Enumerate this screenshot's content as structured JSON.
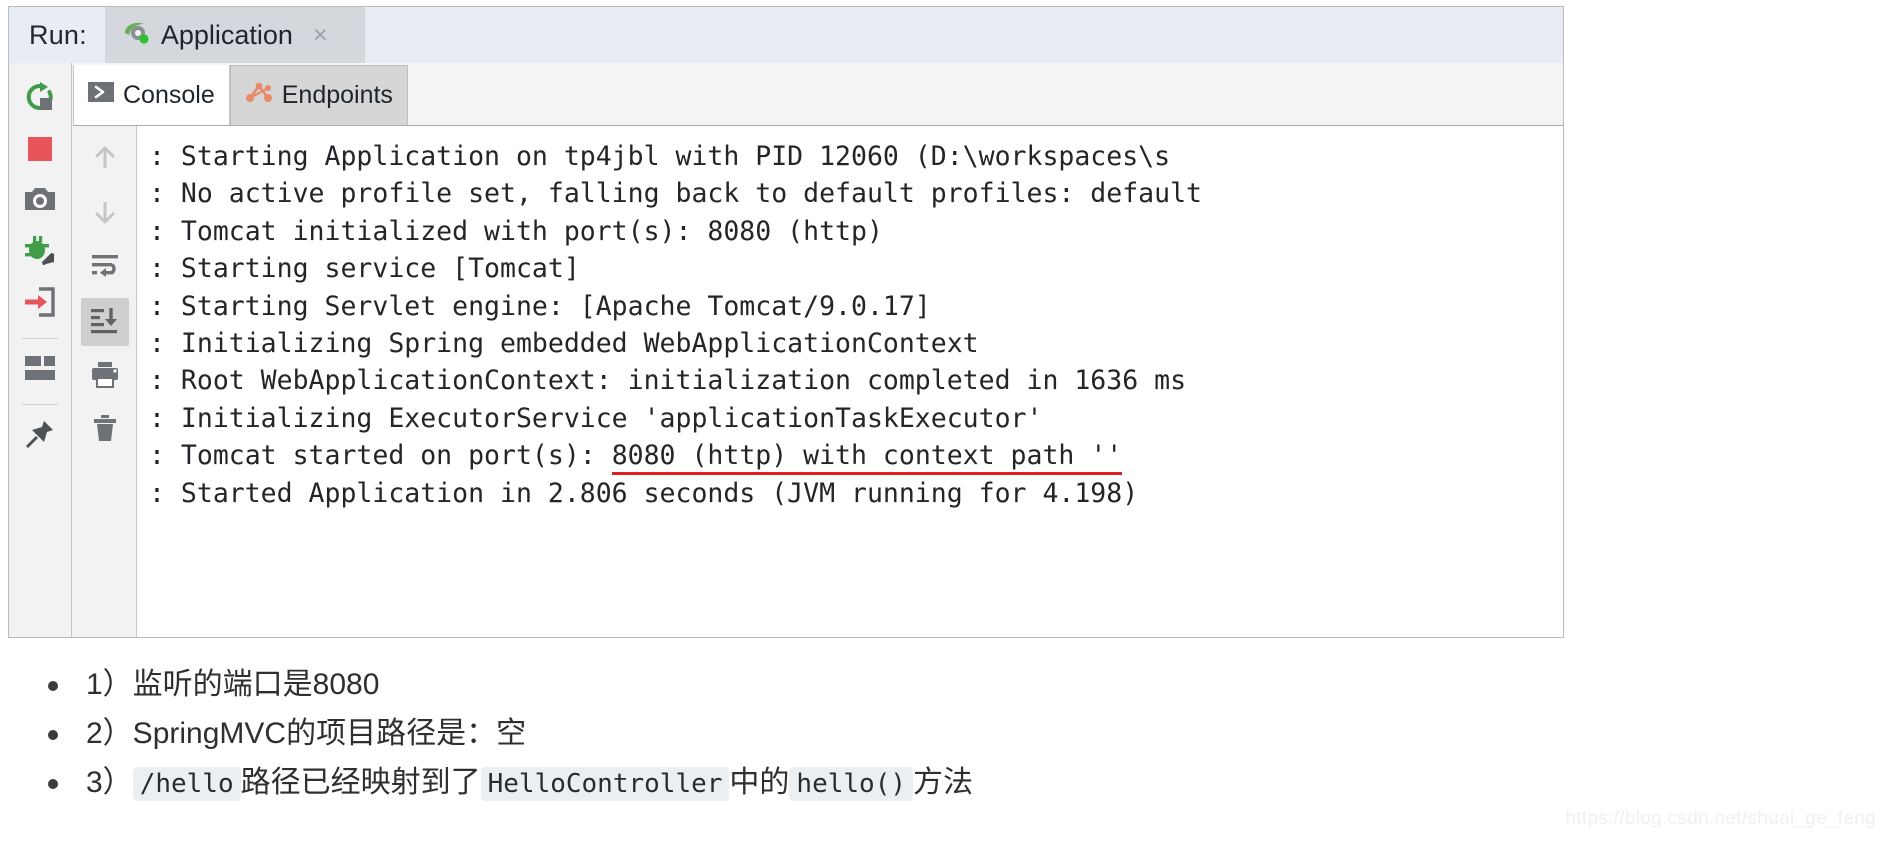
{
  "run_panel": {
    "run_label": "Run:",
    "tab": {
      "title": "Application",
      "close_label": "×",
      "icon": "spring-boot-run-icon"
    },
    "left_toolbar": [
      {
        "name": "rerun-button",
        "icon": "rerun-icon",
        "title": "Rerun"
      },
      {
        "name": "stop-button",
        "icon": "stop-square-icon",
        "title": "Stop"
      },
      {
        "name": "screenshot-button",
        "icon": "camera-icon",
        "title": "Camera"
      },
      {
        "name": "debug-attach-button",
        "icon": "bug-arrow-icon",
        "title": "Attach debugger"
      },
      {
        "name": "step-into-button",
        "icon": "enter-arrow-icon",
        "title": "Step into"
      },
      {
        "name": "layout-button",
        "icon": "layout-icon",
        "title": "Layout"
      },
      {
        "name": "pin-button",
        "icon": "pin-icon",
        "title": "Pin tab"
      }
    ],
    "tabs": [
      {
        "name": "tab-console",
        "label": "Console",
        "icon": "console-chevron-icon",
        "active": true
      },
      {
        "name": "tab-endpoints",
        "label": "Endpoints",
        "icon": "endpoints-graph-icon",
        "active": false
      }
    ],
    "console_toolbar": [
      {
        "name": "up-button",
        "icon": "arrow-up-icon",
        "active": false
      },
      {
        "name": "down-button",
        "icon": "arrow-down-icon",
        "active": false
      },
      {
        "name": "soft-wrap-button",
        "icon": "soft-wrap-icon",
        "active": false
      },
      {
        "name": "scroll-to-end-button",
        "icon": "scroll-to-end-icon",
        "active": true
      },
      {
        "name": "print-button",
        "icon": "printer-icon",
        "active": false
      },
      {
        "name": "clear-all-button",
        "icon": "trash-icon",
        "active": false
      }
    ],
    "console_lines": [
      {
        "text": ": Starting Application on tp4jbl with PID 12060 (D:\\workspaces\\s",
        "underline": false
      },
      {
        "text": ": No active profile set, falling back to default profiles: default",
        "underline": false
      },
      {
        "text": ": Tomcat initialized with port(s): 8080 (http)",
        "underline": false
      },
      {
        "text": ": Starting service [Tomcat]",
        "underline": false
      },
      {
        "text": ": Starting Servlet engine: [Apache Tomcat/9.0.17]",
        "underline": false
      },
      {
        "text": ": Initializing Spring embedded WebApplicationContext",
        "underline": false
      },
      {
        "text": ": Root WebApplicationContext: initialization completed in 1636 ms",
        "underline": false
      },
      {
        "text": ": Initializing ExecutorService 'applicationTaskExecutor'",
        "underline": false
      },
      {
        "text": ": Tomcat started on port(s): ",
        "underline_text": "8080 (http) with context path ''",
        "underline": true
      },
      {
        "text": ": Started Application in 2.806 seconds (JVM running for 4.198)",
        "underline": false
      }
    ]
  },
  "notes": [
    {
      "name": "note-item-1",
      "parts": [
        {
          "type": "text",
          "value": "1）监听的端口是8080"
        }
      ]
    },
    {
      "name": "note-item-2",
      "parts": [
        {
          "type": "text",
          "value": "2）SpringMVC的项目路径是：空"
        }
      ]
    },
    {
      "name": "note-item-3",
      "parts": [
        {
          "type": "text",
          "value": "3）"
        },
        {
          "type": "code",
          "value": "/hello"
        },
        {
          "type": "text",
          "value": "路径已经映射到了"
        },
        {
          "type": "code",
          "value": "HelloController"
        },
        {
          "type": "text",
          "value": "中的"
        },
        {
          "type": "code",
          "value": "hello()"
        },
        {
          "type": "text",
          "value": "方法"
        }
      ]
    }
  ],
  "watermark": "https://blog.csdn.net/shuai_ge_feng",
  "colors": {
    "accent_red_underline": "#e02020",
    "stop_red": "#e8545a",
    "rerun_green": "#3f9d4a",
    "endpoints_orange": "#e8896a",
    "titlebar_bg": "#e8ecf3",
    "tab_active_bg": "#d4d8dc",
    "console_bg": "#ffffff"
  }
}
